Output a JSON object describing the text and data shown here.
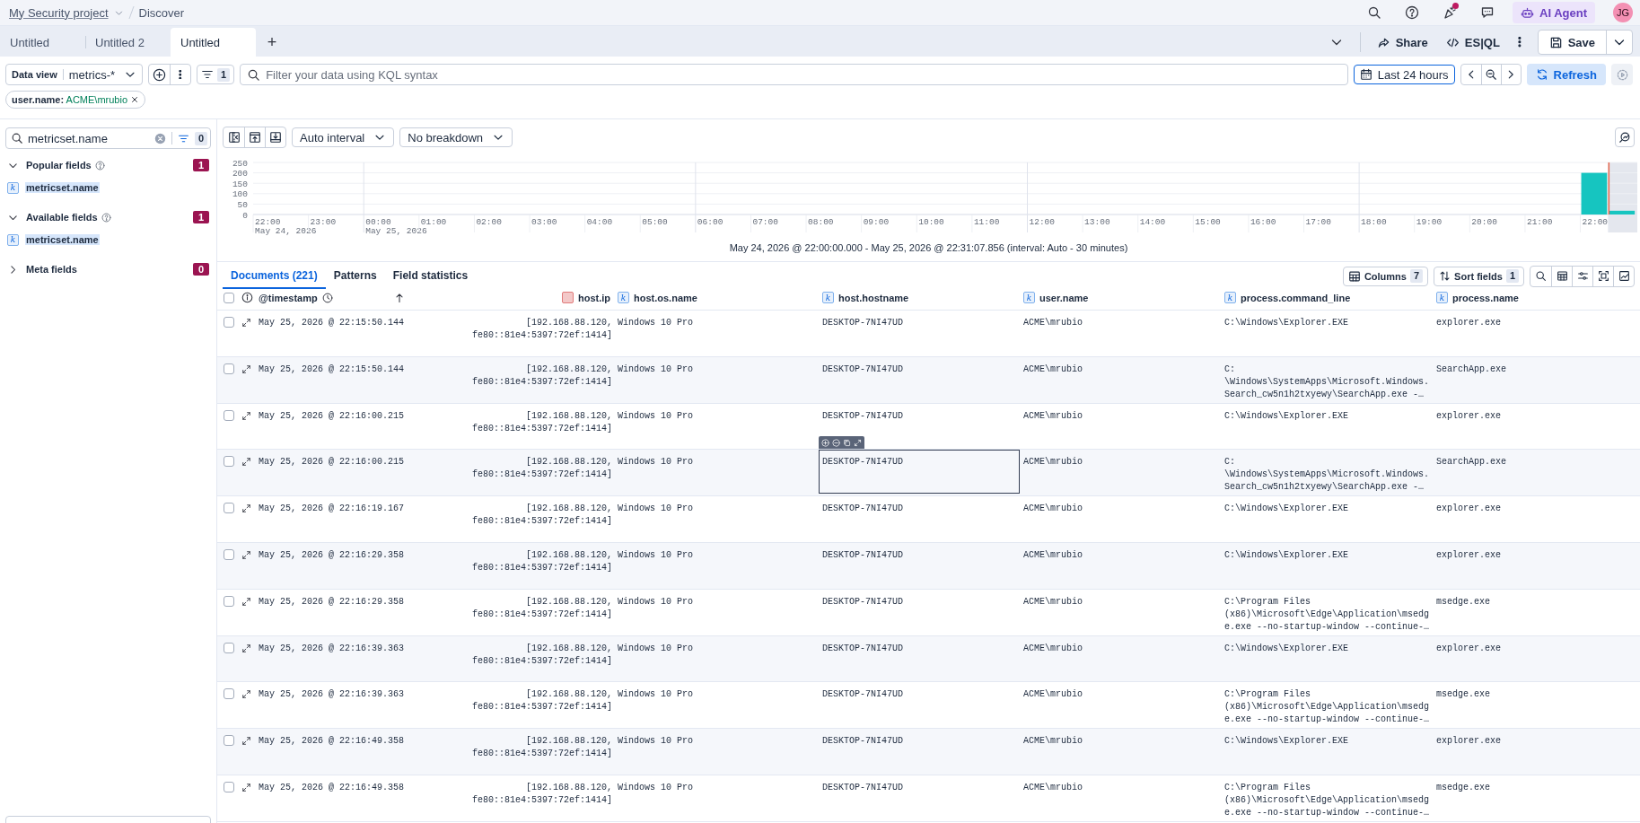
{
  "breadcrumbs": [
    {
      "label": "My Security project",
      "kind": "project"
    },
    {
      "label": "Discover",
      "kind": "page"
    }
  ],
  "header": {
    "ai_button": "AI Agent",
    "avatar": "JG",
    "notification": true
  },
  "tabs": [
    {
      "label": "Untitled",
      "selected": false
    },
    {
      "label": "Untitled 2",
      "selected": false
    },
    {
      "label": "Untitled",
      "selected": true
    }
  ],
  "add_tab": "+",
  "actions": {
    "share": "Share",
    "esql": "ES|QL",
    "save": "Save"
  },
  "query_bar": {
    "data_view_label": "Data view",
    "data_view": "metrics-*",
    "filter_count": "1",
    "placeholder": "Filter your data using KQL syntax",
    "date_range": "Last 24 hours",
    "refresh": "Refresh"
  },
  "filters": [
    {
      "field": "user.name:",
      "value": "ACME\\mrubio"
    }
  ],
  "sidebar": {
    "search_value": "metricset.name",
    "filter_count": "0",
    "sections": [
      {
        "title": "Popular fields",
        "expanded": true,
        "has_help": true,
        "count": "1",
        "fields": [
          {
            "name": "metricset.name",
            "badge": "k"
          }
        ]
      },
      {
        "title": "Available fields",
        "expanded": true,
        "has_help": true,
        "count": "1",
        "fields": [
          {
            "name": "metricset.name",
            "badge": "k"
          }
        ]
      },
      {
        "title": "Meta fields",
        "expanded": false,
        "has_help": false,
        "count": "0"
      }
    ]
  },
  "chart_toolbar": {
    "interval": "Auto interval",
    "breakdown": "No breakdown"
  },
  "histogram": {
    "chart_data": {
      "type": "bar",
      "grid": true,
      "ylim": [
        0,
        250
      ],
      "yticks": [
        0,
        50,
        100,
        150,
        200,
        250
      ],
      "categories": [
        "22:00\nMay 24, 2026",
        null,
        "23:00",
        null,
        "00:00\nMay 25, 2026",
        null,
        "01:00",
        null,
        "02:00",
        null,
        "03:00",
        null,
        "04:00",
        null,
        "05:00",
        null,
        "06:00",
        null,
        "07:00",
        null,
        "08:00",
        null,
        "09:00",
        null,
        "10:00",
        null,
        "11:00",
        null,
        "12:00",
        null,
        "13:00",
        null,
        "14:00",
        null,
        "15:00",
        null,
        "16:00",
        null,
        "17:00",
        null,
        "18:00",
        null,
        "19:00",
        null,
        "20:00",
        null,
        "21:00",
        null,
        "22:00",
        null
      ],
      "values": [
        0,
        0,
        0,
        0,
        0,
        0,
        0,
        0,
        0,
        0,
        0,
        0,
        0,
        0,
        0,
        0,
        0,
        0,
        0,
        0,
        0,
        0,
        0,
        0,
        0,
        0,
        0,
        0,
        0,
        0,
        0,
        0,
        0,
        0,
        0,
        0,
        0,
        0,
        0,
        0,
        0,
        0,
        0,
        0,
        0,
        0,
        0,
        0,
        200,
        18
      ]
    },
    "time_range": "May 24, 2026 @ 22:00:00.000 - May 25, 2026 @ 22:31:07.856 (interval: Auto - 30 minutes)"
  },
  "results_tabs": [
    {
      "label": "Documents (221)",
      "selected": true
    },
    {
      "label": "Patterns",
      "selected": false
    },
    {
      "label": "Field statistics",
      "selected": false
    }
  ],
  "table_toolbar": {
    "columns": "Columns",
    "columns_count": "7",
    "sort": "Sort fields",
    "sort_count": "1"
  },
  "table": {
    "select_all_checked": false,
    "columns": [
      {
        "name": "@timestamp",
        "kind": "date"
      },
      {
        "name": "host.ip",
        "kind": "ip"
      },
      {
        "name": "host.os.name",
        "kind": "keyword",
        "badge": "k"
      },
      {
        "name": "host.hostname",
        "kind": "keyword",
        "badge": "k"
      },
      {
        "name": "user.name",
        "kind": "keyword",
        "badge": "k"
      },
      {
        "name": "process.command_line",
        "kind": "keyword",
        "badge": "k"
      },
      {
        "name": "process.name",
        "kind": "keyword",
        "badge": "k"
      }
    ],
    "rows": [
      {
        "checked": false,
        "hostname_cell_focused": false,
        "cells": [
          "May 25, 2026 @ 22:15:50.144",
          "[192.168.88.120, fe80::81e4:5397:72ef:1414]",
          "Windows 10 Pro",
          "DESKTOP-7NI47UD",
          "ACME\\mrubio",
          "C:\\Windows\\Explorer.EXE",
          "explorer.exe"
        ]
      },
      {
        "checked": false,
        "hostname_cell_focused": false,
        "cells": [
          "May 25, 2026 @ 22:15:50.144",
          "[192.168.88.120, fe80::81e4:5397:72ef:1414]",
          "Windows 10 Pro",
          "DESKTOP-7NI47UD",
          "ACME\\mrubio",
          "C:\n\\Windows\\SystemApps\\Microsoft.Windows.\nSearch_cw5n1h2txyewy\\SearchApp.exe -…",
          "SearchApp.exe"
        ]
      },
      {
        "checked": false,
        "hostname_cell_focused": false,
        "cells": [
          "May 25, 2026 @ 22:16:00.215",
          "[192.168.88.120, fe80::81e4:5397:72ef:1414]",
          "Windows 10 Pro",
          "DESKTOP-7NI47UD",
          "ACME\\mrubio",
          "C:\\Windows\\Explorer.EXE",
          "explorer.exe"
        ]
      },
      {
        "checked": false,
        "hostname_cell_focused": true,
        "cells": [
          "May 25, 2026 @ 22:16:00.215",
          "[192.168.88.120, fe80::81e4:5397:72ef:1414]",
          "Windows 10 Pro",
          "DESKTOP-7NI47UD",
          "ACME\\mrubio",
          "C:\n\\Windows\\SystemApps\\Microsoft.Windows.\nSearch_cw5n1h2txyewy\\SearchApp.exe -…",
          "SearchApp.exe"
        ]
      },
      {
        "checked": false,
        "hostname_cell_focused": false,
        "cells": [
          "May 25, 2026 @ 22:16:19.167",
          "[192.168.88.120, fe80::81e4:5397:72ef:1414]",
          "Windows 10 Pro",
          "DESKTOP-7NI47UD",
          "ACME\\mrubio",
          "C:\\Windows\\Explorer.EXE",
          "explorer.exe"
        ]
      },
      {
        "checked": false,
        "hostname_cell_focused": false,
        "cells": [
          "May 25, 2026 @ 22:16:29.358",
          "[192.168.88.120, fe80::81e4:5397:72ef:1414]",
          "Windows 10 Pro",
          "DESKTOP-7NI47UD",
          "ACME\\mrubio",
          "C:\\Windows\\Explorer.EXE",
          "explorer.exe"
        ]
      },
      {
        "checked": false,
        "hostname_cell_focused": false,
        "cells": [
          "May 25, 2026 @ 22:16:29.358",
          "[192.168.88.120, fe80::81e4:5397:72ef:1414]",
          "Windows 10 Pro",
          "DESKTOP-7NI47UD",
          "ACME\\mrubio",
          "C:\\Program Files\n(x86)\\Microsoft\\Edge\\Application\\msedg\ne.exe --no-startup-window --continue-…",
          "msedge.exe"
        ]
      },
      {
        "checked": false,
        "hostname_cell_focused": false,
        "cells": [
          "May 25, 2026 @ 22:16:39.363",
          "[192.168.88.120, fe80::81e4:5397:72ef:1414]",
          "Windows 10 Pro",
          "DESKTOP-7NI47UD",
          "ACME\\mrubio",
          "C:\\Windows\\Explorer.EXE",
          "explorer.exe"
        ]
      },
      {
        "checked": false,
        "hostname_cell_focused": false,
        "cells": [
          "May 25, 2026 @ 22:16:39.363",
          "[192.168.88.120, fe80::81e4:5397:72ef:1414]",
          "Windows 10 Pro",
          "DESKTOP-7NI47UD",
          "ACME\\mrubio",
          "C:\\Program Files\n(x86)\\Microsoft\\Edge\\Application\\msedg\ne.exe --no-startup-window --continue-…",
          "msedge.exe"
        ]
      },
      {
        "checked": false,
        "hostname_cell_focused": false,
        "cells": [
          "May 25, 2026 @ 22:16:49.358",
          "[192.168.88.120, fe80::81e4:5397:72ef:1414]",
          "Windows 10 Pro",
          "DESKTOP-7NI47UD",
          "ACME\\mrubio",
          "C:\\Windows\\Explorer.EXE",
          "explorer.exe"
        ]
      },
      {
        "checked": false,
        "hostname_cell_focused": false,
        "cells": [
          "May 25, 2026 @ 22:16:49.358",
          "[192.168.88.120, fe80::81e4:5397:72ef:1414]",
          "Windows 10 Pro",
          "DESKTOP-7NI47UD",
          "ACME\\mrubio",
          "C:\\Program Files\n(x86)\\Microsoft\\Edge\\Application\\msedg\ne.exe --no-startup-window --continue-…",
          "msedge.exe"
        ]
      }
    ]
  }
}
